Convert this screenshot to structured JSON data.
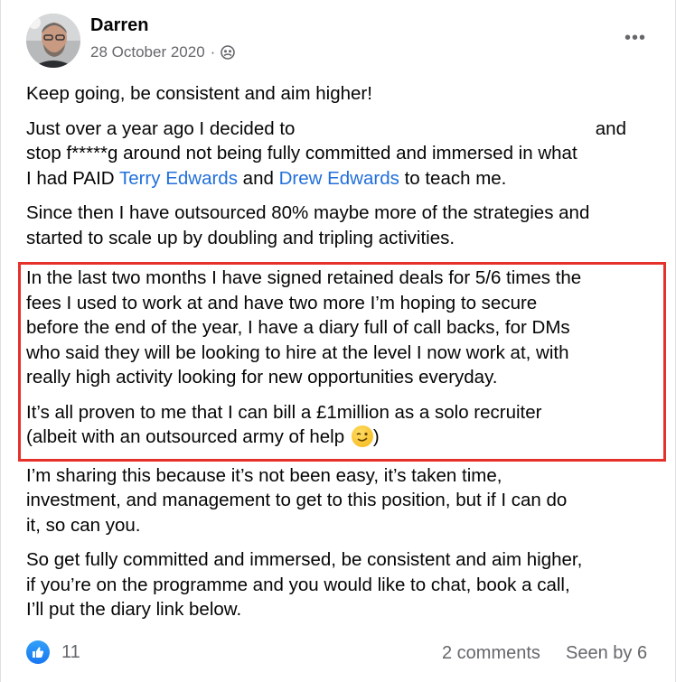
{
  "post": {
    "author": "Darren",
    "date": "28 October 2020",
    "separator": "·",
    "audience_icon": "group-audience-icon",
    "more_icon": "more-options-icon",
    "more_label": "•••",
    "paragraphs": {
      "p1": "Keep going, be consistent and aim higher!",
      "p2_line1_start": "Just over a year ago I decided to",
      "p2_line1_end": "and",
      "p2_line2": "stop f*****g around not being fully committed and immersed in what",
      "p2_line3_pre": "I had PAID ",
      "p2_link1": "Terry Edwards",
      "p2_line3_mid": " and ",
      "p2_link2": "Drew Edwards",
      "p2_line3_post": " to teach me.",
      "p3_line1": "Since then I have outsourced 80% maybe more of the strategies and",
      "p3_line2": "started to scale up by doubling and tripling activities.",
      "p4_line1": "In the last two months I have signed retained deals for 5/6 times the",
      "p4_line2": "fees I used to work at and have two more I’m hoping to secure",
      "p4_line3": "before the end of the year, I have a diary full of call backs, for DMs",
      "p4_line4": "who said they will be looking to hire at the level I now work at, with",
      "p4_line5": "really high activity looking for new opportunities everyday.",
      "p5_line1": "It’s all proven to me that I can bill a £1million as a solo recruiter",
      "p5_line2_pre": "(albeit with an outsourced army of help ",
      "p5_line2_post": ")",
      "p6_line1": "I’m sharing this because it’s not been easy, it’s taken time,",
      "p6_line2": "investment, and management to get to this position, but if I can do",
      "p6_line3": "it, so can you.",
      "p7_line1": "So get fully committed and immersed, be consistent and aim higher,",
      "p7_line2": "if you’re on the programme and you would like to chat, book a call,",
      "p7_line3": "I’ll put the diary link below."
    },
    "emoji": "winking-face-emoji",
    "highlight_color": "#e5312a",
    "link_color": "#216fdb"
  },
  "footer": {
    "like_icon": "thumbs-up-icon",
    "like_count": "11",
    "comments": "2 comments",
    "seen_by": "Seen by 6"
  }
}
